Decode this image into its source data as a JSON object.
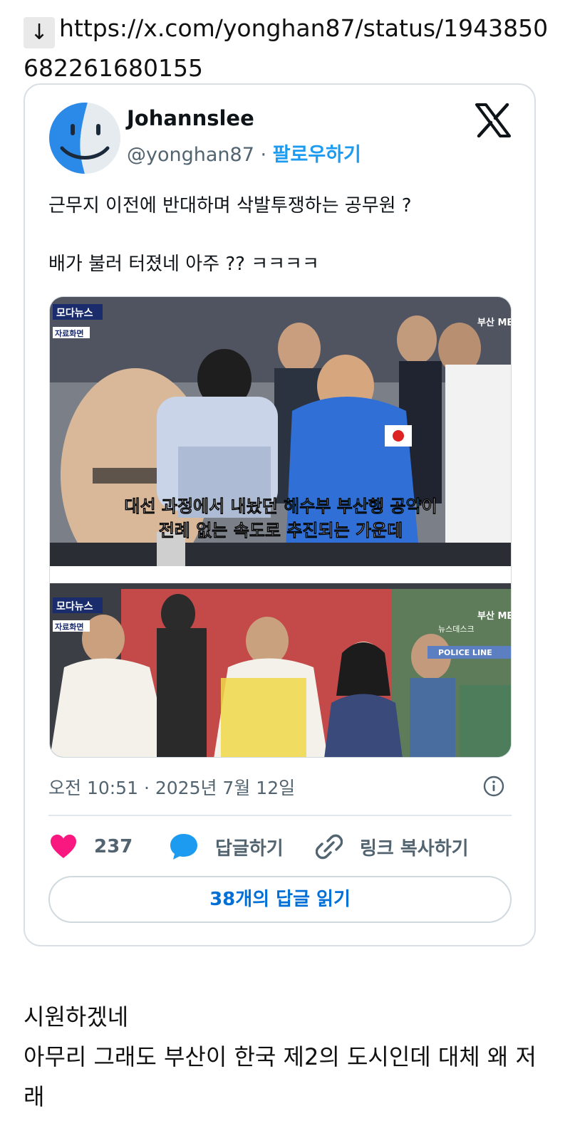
{
  "link": {
    "arrow": "↓",
    "url": "https://x.com/yonghan87/status/1943850682261680155"
  },
  "tweet": {
    "display_name": "Johannslee",
    "handle": "@yonghan87",
    "separator": "·",
    "follow_label": "팔로우하기",
    "text_line_1": "근무지 이전에 반대하며 삭발투쟁하는 공무원 ?",
    "text_line_2": "배가 불러 터졌네 아주 ?? ㅋㅋㅋㅋ",
    "media": {
      "top": {
        "channel_label": "모다뉴스",
        "source_label": "자료화면",
        "broadcaster": "부산 MBC NEWS",
        "caption_line_1_white": "대선 과정에서 내놨던 ",
        "caption_line_1_highlight": "해수부 부산행 공약",
        "caption_line_1_end": "이",
        "caption_line_2_white": "전례 없는 속도로 ",
        "caption_line_2_highlight": "추진",
        "caption_line_2_end": "되는 가운데"
      },
      "bottom": {
        "channel_label": "모다뉴스",
        "source_label": "자료화면",
        "broadcaster": "부산 MBC NEWS",
        "desk_label": "뉴스데스크",
        "police_label": "POLICE LINE"
      }
    },
    "time": "오전 10:51",
    "date": "2025년 7월 12일",
    "like_count": "237",
    "reply_label": "답글하기",
    "copy_link_label": "링크 복사하기",
    "read_replies_label": "38개의 답글 읽기"
  },
  "comment": {
    "line_1": "시원하겠네",
    "line_2": "아무리 그래도 부산이 한국 제2의 도시인데 대체 왜 저래"
  },
  "colors": {
    "accent_blue": "#1d9bf0",
    "link_blue": "#006fd6",
    "like_pink": "#f91880",
    "caption_highlight": "#5ec8f0",
    "border": "#cfd9de"
  },
  "icons": [
    "download-arrow-icon",
    "finder-avatar-icon",
    "x-logo-icon",
    "info-icon",
    "heart-icon",
    "reply-bubble-icon",
    "link-icon"
  ]
}
